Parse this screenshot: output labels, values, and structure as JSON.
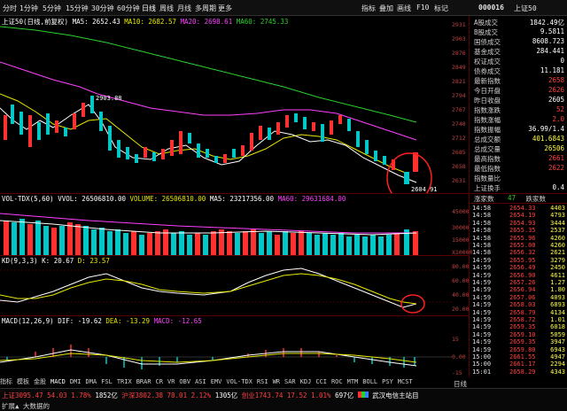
{
  "topbar": {
    "periods": [
      "分时",
      "1分钟",
      "5分钟",
      "15分钟",
      "30分钟",
      "60分钟",
      "日线",
      "周线",
      "月线",
      "多周期",
      "更多"
    ],
    "tools": [
      "指标",
      "叠加",
      "画线",
      "F10",
      "标记"
    ],
    "symbol_code": "000016",
    "symbol_name": "上证50"
  },
  "main_panel": {
    "title": "上证50(日线,前复权)",
    "ma5_label": "MA5: 2652.43",
    "ma10_label": "MA10: 2682.57",
    "ma20_label": "MA20: 2698.61",
    "ma60_label": "MA60: 2745.33",
    "high_marker": "2903.88",
    "low_marker": "2604.91",
    "axis_ticks": [
      "2931",
      "2903",
      "2876",
      "2849",
      "2821",
      "2794",
      "2767",
      "2740",
      "2712",
      "2685",
      "2658",
      "2631"
    ]
  },
  "volume_panel": {
    "title": "VOL-TDX(5,60)",
    "vvol": "VVOL: 26506810.00",
    "volume": "VOLUME: 26506810.00",
    "ma5": "MA5: 23217356.00",
    "ma60": "MA60: 29631684.00",
    "axis_ticks": [
      "45000",
      "30000",
      "15000",
      "X10000"
    ]
  },
  "kd_panel": {
    "title": "KD(9,3,3)",
    "k": "K: 20.67",
    "d": "D: 23.57",
    "axis_ticks": [
      "80.00",
      "60.00",
      "40.00",
      "20.00"
    ]
  },
  "macd_panel": {
    "title": "MACD(12,26,9)",
    "dif": "DIF: -19.62",
    "dea": "DEA: -13.29",
    "macd": "MACD: -12.65",
    "axis_ticks": [
      "15",
      "0.00",
      "-15"
    ]
  },
  "indicator_tabs": [
    "指标",
    "模板",
    "金股",
    "MACD",
    "DMI",
    "DMA",
    "FSL",
    "TRIX",
    "BRAR",
    "CR",
    "VR",
    "OBV",
    "ASI",
    "EMV",
    "VOL-TDX",
    "RSI",
    "WR",
    "SAR",
    "KDJ",
    "CCI",
    "ROC",
    "MTM",
    "BOLL",
    "PSY",
    "MCST"
  ],
  "side_stats": [
    {
      "label": "A股成交",
      "value": "1842.49亿",
      "color": "#ffffff"
    },
    {
      "label": "B股成交",
      "value": "9.5811",
      "color": "#ffffff"
    },
    {
      "label": "国债成交",
      "value": "8608.723",
      "color": "#ffffff"
    },
    {
      "label": "基金成交",
      "value": "284.441",
      "color": "#ffffff"
    },
    {
      "label": "权证成交",
      "value": "0",
      "color": "#ffffff"
    },
    {
      "label": "债券成交",
      "value": "11.181",
      "color": "#ffffff"
    },
    {
      "label": "最新指数",
      "value": "2658",
      "color": "#ff4040"
    },
    {
      "label": "今日开盘",
      "value": "2626",
      "color": "#ff4040"
    },
    {
      "label": "昨日收盘",
      "value": "2605",
      "color": "#ffffff"
    },
    {
      "label": "指数涨跌",
      "value": "52",
      "color": "#ff4040"
    },
    {
      "label": "指数涨幅",
      "value": "2.0",
      "color": "#ff4040"
    },
    {
      "label": "指数振幅",
      "value": "36.99/1.4",
      "color": "#ffffff"
    },
    {
      "label": "总成交额",
      "value": "401.6843",
      "color": "#ffff40"
    },
    {
      "label": "总成交量",
      "value": "26506",
      "color": "#ffff40"
    },
    {
      "label": "最高指数",
      "value": "2661",
      "color": "#ff4040"
    },
    {
      "label": "最低指数",
      "value": "2622",
      "color": "#ff4040"
    },
    {
      "label": "指数量比",
      "value": "",
      "color": "#ffffff"
    },
    {
      "label": "上证换手",
      "value": "0.4",
      "color": "#ffffff"
    }
  ],
  "ratio_row": {
    "up_label": "涨家数",
    "down_count": "47",
    "down_label": "跌家数"
  },
  "ticks": [
    {
      "t": "14:58",
      "p": "2654.33",
      "q": "4403"
    },
    {
      "t": "14:58",
      "p": "2654.19",
      "q": "4793"
    },
    {
      "t": "14:58",
      "p": "2654.93",
      "q": "3444"
    },
    {
      "t": "14:58",
      "p": "2655.35",
      "q": "2537"
    },
    {
      "t": "14:58",
      "p": "2655.96",
      "q": "4260"
    },
    {
      "t": "14:58",
      "p": "2655.00",
      "q": "4260"
    },
    {
      "t": "14:58",
      "p": "2656.32",
      "q": "2621"
    },
    {
      "t": "14:59",
      "p": "2655.95",
      "q": "3279"
    },
    {
      "t": "14:59",
      "p": "2656.49",
      "q": "2450"
    },
    {
      "t": "14:59",
      "p": "2656.90",
      "q": "4611"
    },
    {
      "t": "14:59",
      "p": "2657.26",
      "q": "1.27"
    },
    {
      "t": "14:59",
      "p": "2656.94",
      "q": "1.80"
    },
    {
      "t": "14:59",
      "p": "2657.06",
      "q": "4093"
    },
    {
      "t": "14:59",
      "p": "2658.03",
      "q": "6893"
    },
    {
      "t": "14:59",
      "p": "2658.79",
      "q": "4134"
    },
    {
      "t": "14:59",
      "p": "2658.72",
      "q": "1.01"
    },
    {
      "t": "14:59",
      "p": "2659.35",
      "q": "6018"
    },
    {
      "t": "14:59",
      "p": "2659.10",
      "q": "5059"
    },
    {
      "t": "14:59",
      "p": "2659.35",
      "q": "3947"
    },
    {
      "t": "14:59",
      "p": "2659.80",
      "q": "6943"
    },
    {
      "t": "15:00",
      "p": "2661.55",
      "q": "4947"
    },
    {
      "t": "15:00",
      "p": "2661.17",
      "q": "2294"
    },
    {
      "t": "15:01",
      "p": "2658.29",
      "q": "4343"
    }
  ],
  "bottombar": {
    "sh": "上证3095.47",
    "sh_chg": "54.03",
    "sh_pct": "1.78%",
    "sh_amt": "1852亿",
    "hs": "沪深3802.38",
    "hs_chg": "78.01",
    "hs_pct": "2.12%",
    "hs_amt": "1305亿",
    "cy": "创业1743.74",
    "cy_chg": "17.52",
    "cy_pct": "1.01%",
    "cy_amt": "697亿",
    "news": "武汉电信主站目",
    "menu": "扩展▲  大数据的",
    "side_tab": "日线"
  }
}
